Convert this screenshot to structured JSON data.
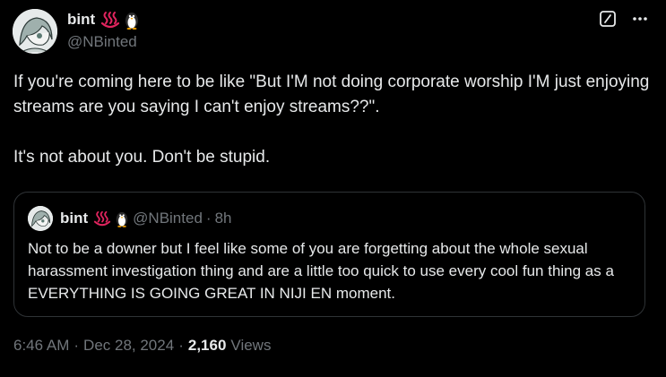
{
  "author": {
    "display_name": "bint",
    "name_emojis": [
      "hot-springs-emoji",
      "penguin-emoji"
    ],
    "handle": "@NBinted"
  },
  "header_actions": [
    "grok-icon",
    "more-icon"
  ],
  "tweet": {
    "paragraphs": [
      "If you're coming here to be like \"But I'M not doing corporate worship I'M just enjoying streams are you saying I can't enjoy streams??\".",
      "It's not about you. Don't be stupid."
    ]
  },
  "quoted_tweet": {
    "display_name": "bint",
    "handle": "@NBinted",
    "separator": "·",
    "time": "8h",
    "text": "Not to be a downer but I feel like some of you are forgetting about the whole sexual harassment investigation thing and are a little too quick to use every cool fun thing as a EVERYTHING IS GOING GREAT IN NIJI EN moment."
  },
  "meta": {
    "time": "6:46 AM",
    "separator": "·",
    "date": "Dec 28, 2024",
    "views_count": "2,160",
    "views_label": "Views"
  },
  "colors": {
    "background": "#000000",
    "text_primary": "#e7e9ea",
    "text_secondary": "#71767b",
    "border": "#2f3336",
    "hot_springs": "#e0245e"
  }
}
